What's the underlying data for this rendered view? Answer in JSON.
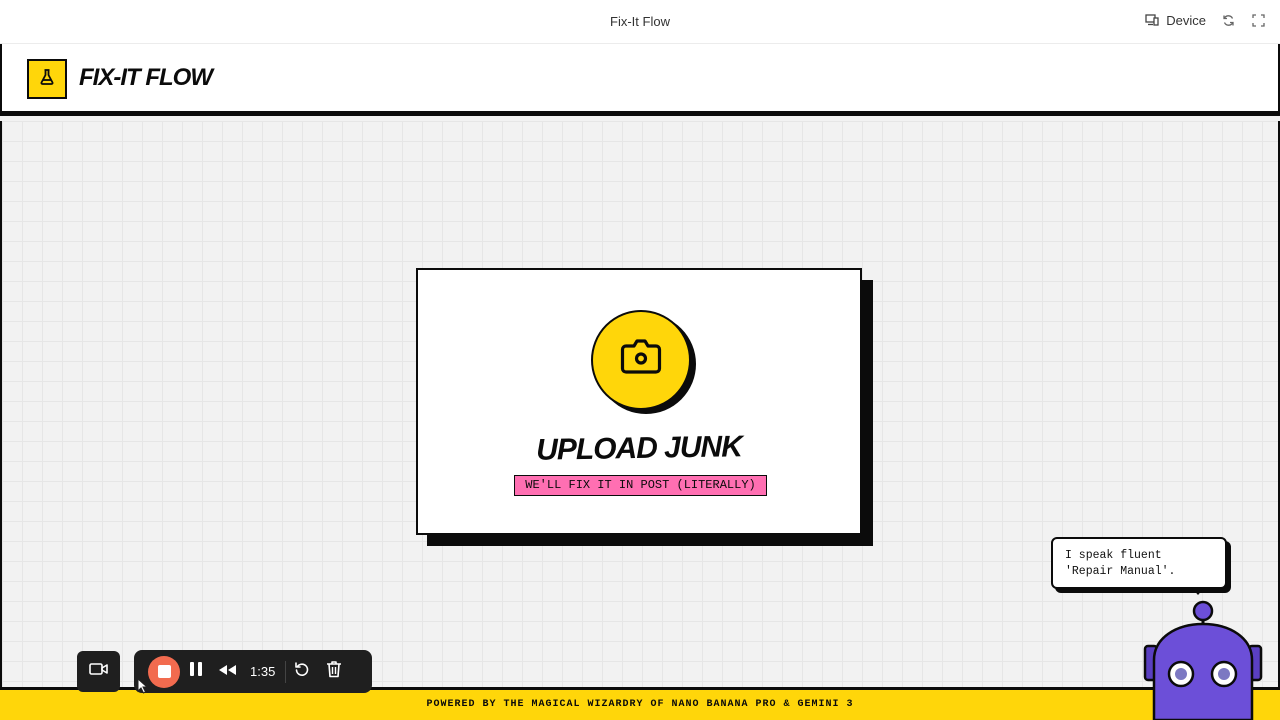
{
  "window": {
    "title": "Fix-It Flow",
    "device_label": "Device",
    "icons": [
      "device-icon",
      "refresh-icon",
      "fullscreen-icon"
    ]
  },
  "header": {
    "logo_icon": "flask-icon",
    "brand": "FIX-IT FLOW"
  },
  "upload": {
    "icon": "camera-icon",
    "title": "UPLOAD JUNK",
    "subtitle": "WE'LL FIX IT IN POST (LITERALLY)"
  },
  "assistant": {
    "message": "I speak fluent 'Repair Manual'.",
    "avatar": "robot-icon"
  },
  "footer": {
    "text": "POWERED BY THE MAGICAL WIZARDRY OF NANO BANANA PRO & GEMINI 3"
  },
  "recorder": {
    "elapsed": "1:35",
    "icons": [
      "video-camera-icon",
      "stop-icon",
      "pause-icon",
      "rewind-icon",
      "restart-icon",
      "trash-icon"
    ]
  },
  "colors": {
    "accent_yellow": "#ffd60a",
    "accent_pink": "#ff6fb2",
    "ink": "#0b0b0b",
    "robot_purple": "#6c4fd8",
    "record_red": "#f26b4f"
  }
}
